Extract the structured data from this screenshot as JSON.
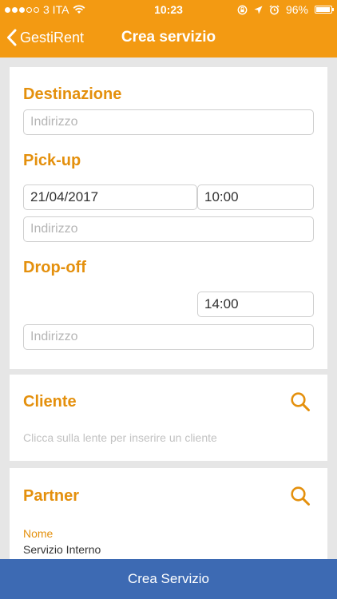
{
  "status_bar": {
    "carrier": "3 ITA",
    "time": "10:23",
    "battery": "96%",
    "battery_level": 0.96
  },
  "nav": {
    "back_label": "GestiRent",
    "title": "Crea servizio"
  },
  "destinazione": {
    "title": "Destinazione",
    "address_placeholder": "Indirizzo"
  },
  "pickup": {
    "title": "Pick-up",
    "date": "21/04/2017",
    "time": "10:00",
    "address_placeholder": "Indirizzo"
  },
  "dropoff": {
    "title": "Drop-off",
    "time": "14:00",
    "address_placeholder": "Indirizzo"
  },
  "cliente": {
    "title": "Cliente",
    "hint": "Clicca sulla lente per inserire un cliente"
  },
  "partner": {
    "title": "Partner",
    "name_label": "Nome",
    "name_value": "Servizio Interno"
  },
  "footer": {
    "button_label": "Crea Servizio"
  },
  "colors": {
    "accent": "#f39a12",
    "section_title": "#e4900d",
    "footer": "#3d6ab3"
  }
}
